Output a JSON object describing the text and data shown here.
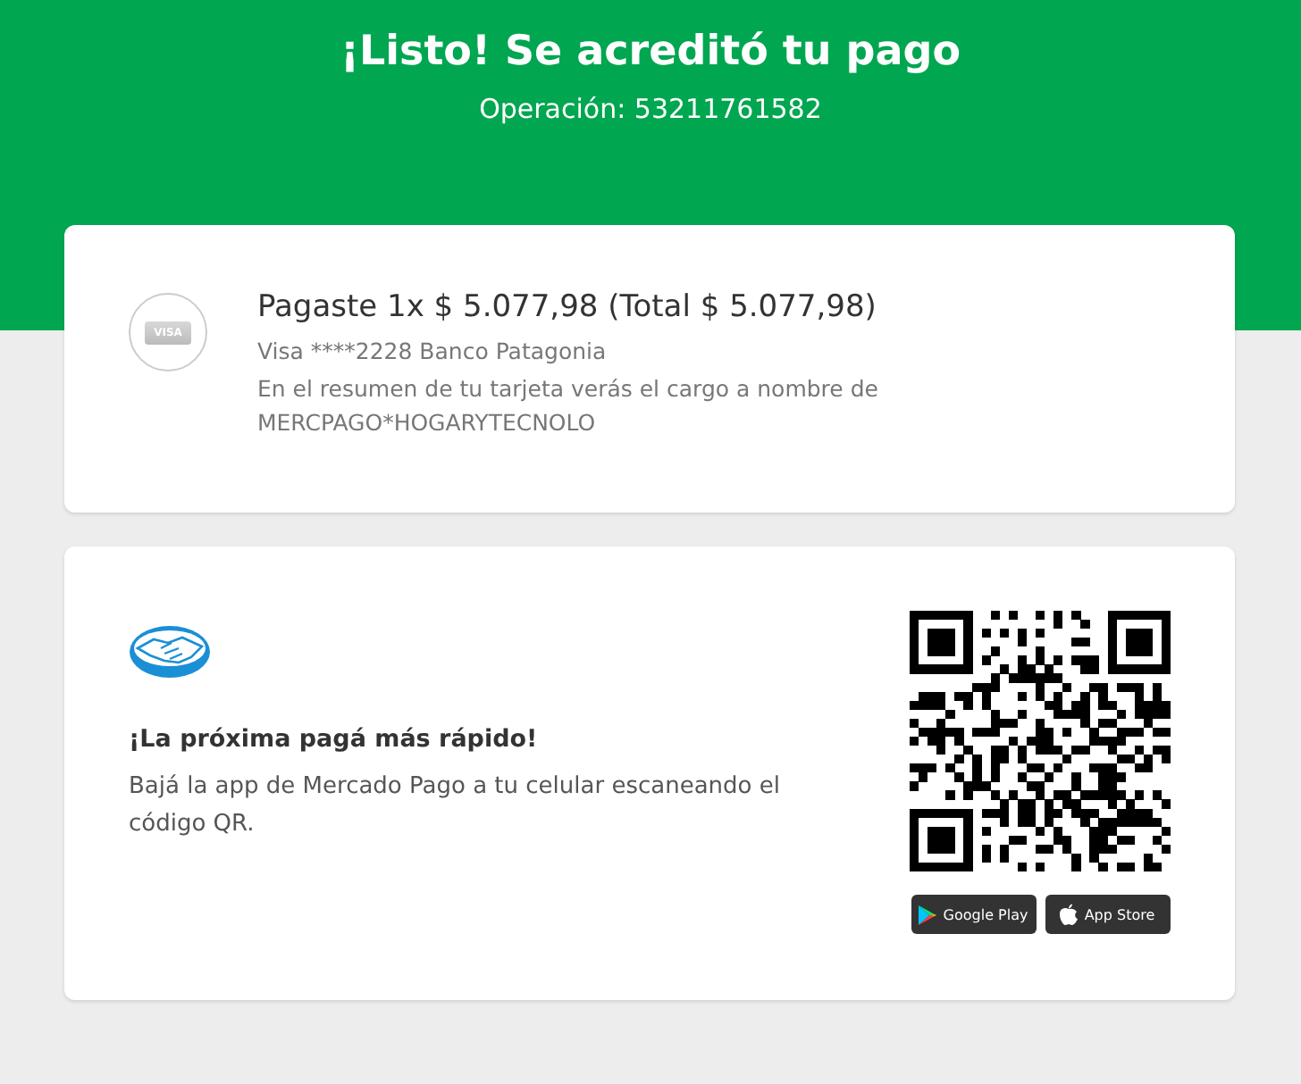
{
  "header": {
    "title": "¡Listo! Se acreditó tu pago",
    "operation": "Operación: 53211761582"
  },
  "payment": {
    "card_brand": "VISA",
    "amount_line": "Pagaste 1x $ 5.077,98 (Total $ 5.077,98)",
    "card_line": "Visa ****2228 Banco Patagonia",
    "statement_line": "En el resumen de tu tarjeta verás el cargo a nombre de MERCPAGO*HOGARYTECNOLO"
  },
  "promo": {
    "heading": "¡La próxima pagá más rápido!",
    "body": "Bajá la app de Mercado Pago a tu celular escaneando el código QR.",
    "stores": [
      {
        "kind": "google",
        "label": "Google Play"
      },
      {
        "kind": "apple",
        "label": "App Store"
      }
    ]
  }
}
